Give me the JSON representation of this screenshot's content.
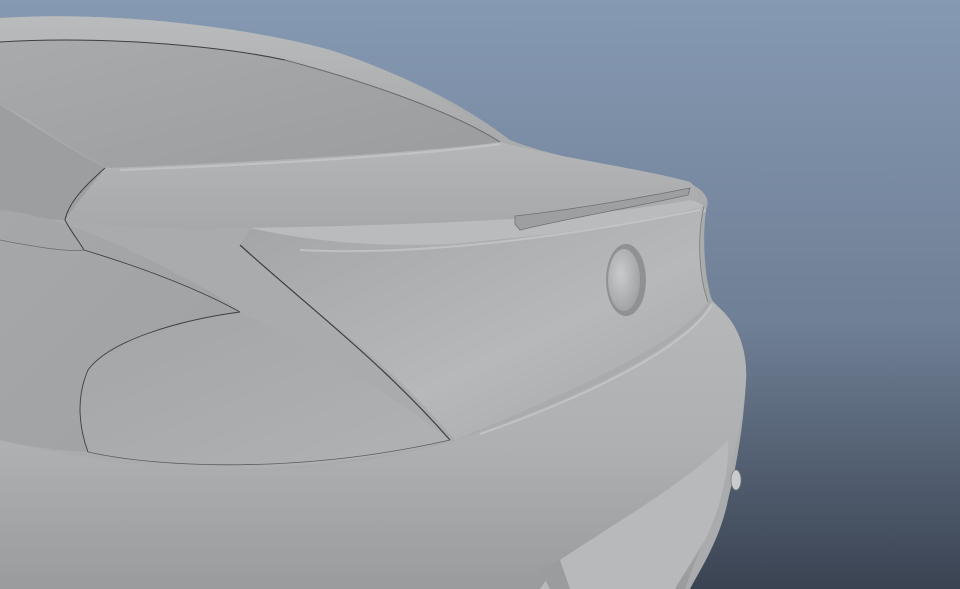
{
  "viewport": {
    "background_top_color": "#8599b2",
    "background_bottom_color": "#3a4352",
    "model_base_color": "#a9abad",
    "model_highlight_color": "#c4c6c8",
    "model_shadow_color": "#7f8183",
    "edge_line_color": "#3d3f41"
  }
}
